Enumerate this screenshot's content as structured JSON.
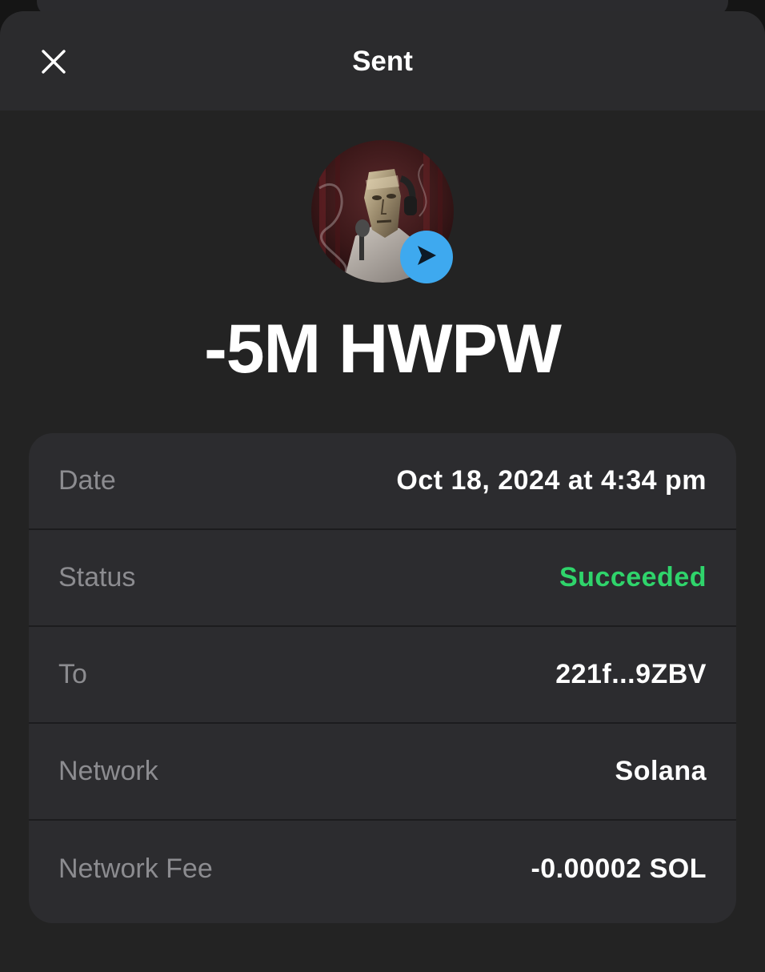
{
  "header": {
    "title": "Sent",
    "close_icon": "close-icon"
  },
  "token": {
    "avatar_icon": "token-avatar",
    "badge_icon": "send-arrow-icon",
    "badge_color": "#3ea9ef",
    "amount": "-5M HWPW"
  },
  "details": {
    "rows": [
      {
        "label": "Date",
        "value": "Oct 18, 2024 at 4:34 pm"
      },
      {
        "label": "Status",
        "value": "Succeeded",
        "value_color": "#2fd46b"
      },
      {
        "label": "To",
        "value": "221f...9ZBV"
      },
      {
        "label": "Network",
        "value": "Solana"
      },
      {
        "label": "Network Fee",
        "value": "-0.00002 SOL"
      }
    ]
  }
}
